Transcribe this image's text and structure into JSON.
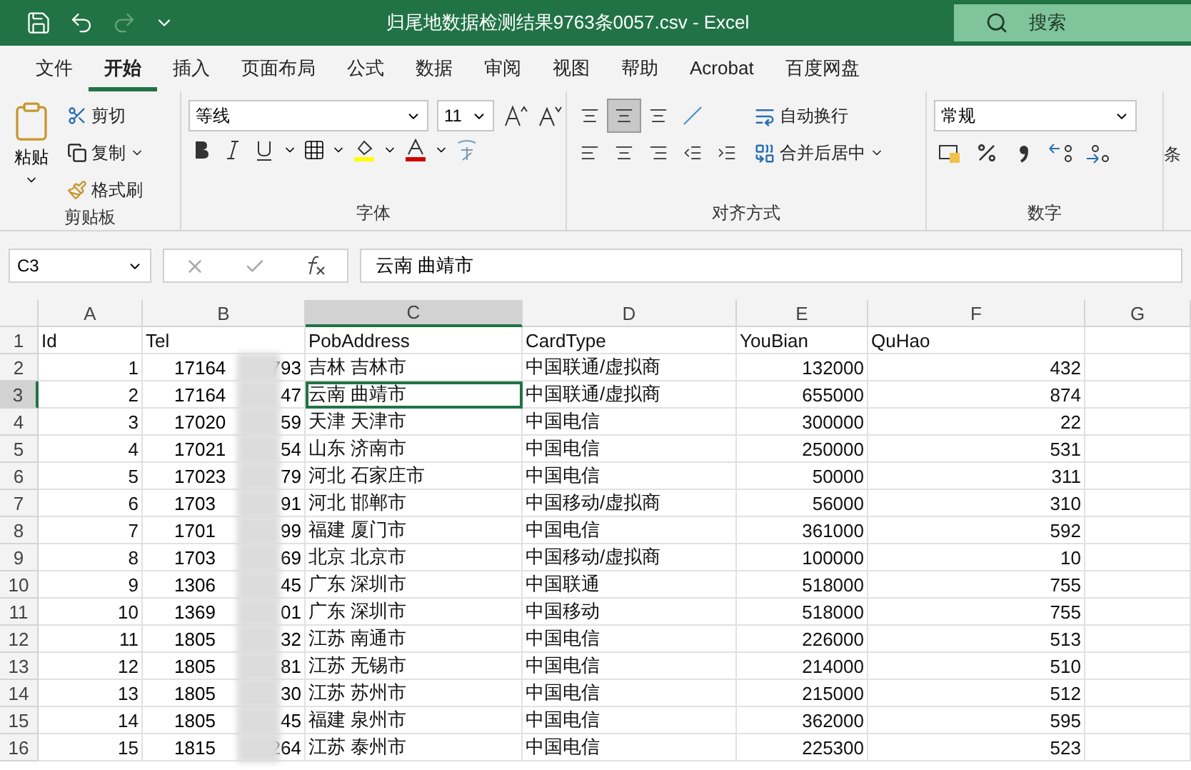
{
  "title_bar": {
    "title": "归尾地数据检测结果9763条0057.csv  -  Excel",
    "search": {
      "placeholder": "搜索"
    }
  },
  "menu_tabs": [
    {
      "label": "文件",
      "selected": false
    },
    {
      "label": "开始",
      "selected": true
    },
    {
      "label": "插入",
      "selected": false
    },
    {
      "label": "页面布局",
      "selected": false
    },
    {
      "label": "公式",
      "selected": false
    },
    {
      "label": "数据",
      "selected": false
    },
    {
      "label": "审阅",
      "selected": false
    },
    {
      "label": "视图",
      "selected": false
    },
    {
      "label": "帮助",
      "selected": false
    },
    {
      "label": "Acrobat",
      "selected": false
    },
    {
      "label": "百度网盘",
      "selected": false
    }
  ],
  "ribbon": {
    "clipboard": {
      "paste": "粘贴",
      "cut": "剪切",
      "copy": "复制",
      "format_painter": "格式刷",
      "label": "剪贴板"
    },
    "font": {
      "font_name": "等线",
      "font_size": "11",
      "label": "字体"
    },
    "alignment": {
      "wrap_text": "自动换行",
      "merge_center": "合并后居中",
      "label": "对齐方式"
    },
    "number": {
      "format": "常规",
      "label": "数字"
    },
    "next_group_label": "条"
  },
  "formula_bar": {
    "name_box": "C3",
    "value": "云南 曲靖市"
  },
  "sheet": {
    "columns": [
      {
        "label": "A",
        "selected": false
      },
      {
        "label": "B",
        "selected": false
      },
      {
        "label": "C",
        "selected": true
      },
      {
        "label": "D",
        "selected": false
      },
      {
        "label": "E",
        "selected": false
      },
      {
        "label": "F",
        "selected": false
      },
      {
        "label": "G",
        "selected": false
      }
    ],
    "header_row": {
      "number": "1",
      "cells": [
        "Id",
        "Tel",
        "PobAddress",
        "CardType",
        "YouBian",
        "QuHao"
      ]
    },
    "rows": [
      {
        "number": "2",
        "selected": false,
        "id": "1",
        "tel_start": "17164",
        "tel_end": "793",
        "address": "吉林 吉林市",
        "card_type": "中国联通/虚拟商",
        "you_bian": "132000",
        "qu_hao": "432"
      },
      {
        "number": "3",
        "selected": true,
        "id": "2",
        "tel_start": "17164",
        "tel_end": "47",
        "address": "云南 曲靖市",
        "card_type": "中国联通/虚拟商",
        "you_bian": "655000",
        "qu_hao": "874"
      },
      {
        "number": "4",
        "selected": false,
        "id": "3",
        "tel_start": "17020",
        "tel_end": "59",
        "address": "天津 天津市",
        "card_type": "中国电信",
        "you_bian": "300000",
        "qu_hao": "22"
      },
      {
        "number": "5",
        "selected": false,
        "id": "4",
        "tel_start": "17021",
        "tel_end": "54",
        "address": "山东 济南市",
        "card_type": "中国电信",
        "you_bian": "250000",
        "qu_hao": "531"
      },
      {
        "number": "6",
        "selected": false,
        "id": "5",
        "tel_start": "17023",
        "tel_end": "79",
        "address": "河北 石家庄市",
        "card_type": "中国电信",
        "you_bian": "50000",
        "qu_hao": "311"
      },
      {
        "number": "7",
        "selected": false,
        "id": "6",
        "tel_start": "1703",
        "tel_end": "91",
        "address": "河北 邯郸市",
        "card_type": "中国移动/虚拟商",
        "you_bian": "56000",
        "qu_hao": "310"
      },
      {
        "number": "8",
        "selected": false,
        "id": "7",
        "tel_start": "1701",
        "tel_end": "99",
        "address": "福建 厦门市",
        "card_type": "中国电信",
        "you_bian": "361000",
        "qu_hao": "592"
      },
      {
        "number": "9",
        "selected": false,
        "id": "8",
        "tel_start": "1703",
        "tel_end": "69",
        "address": "北京 北京市",
        "card_type": "中国移动/虚拟商",
        "you_bian": "100000",
        "qu_hao": "10"
      },
      {
        "number": "10",
        "selected": false,
        "id": "9",
        "tel_start": "1306",
        "tel_end": "45",
        "address": "广东 深圳市",
        "card_type": "中国联通",
        "you_bian": "518000",
        "qu_hao": "755"
      },
      {
        "number": "11",
        "selected": false,
        "id": "10",
        "tel_start": "1369",
        "tel_end": "01",
        "address": "广东 深圳市",
        "card_type": "中国移动",
        "you_bian": "518000",
        "qu_hao": "755"
      },
      {
        "number": "12",
        "selected": false,
        "id": "11",
        "tel_start": "1805",
        "tel_end": "32",
        "address": "江苏 南通市",
        "card_type": "中国电信",
        "you_bian": "226000",
        "qu_hao": "513"
      },
      {
        "number": "13",
        "selected": false,
        "id": "12",
        "tel_start": "1805",
        "tel_end": "81",
        "address": "江苏 无锡市",
        "card_type": "中国电信",
        "you_bian": "214000",
        "qu_hao": "510"
      },
      {
        "number": "14",
        "selected": false,
        "id": "13",
        "tel_start": "1805",
        "tel_end": "30",
        "address": "江苏 苏州市",
        "card_type": "中国电信",
        "you_bian": "215000",
        "qu_hao": "512"
      },
      {
        "number": "15",
        "selected": false,
        "id": "14",
        "tel_start": "1805",
        "tel_end": "45",
        "address": "福建 泉州市",
        "card_type": "中国电信",
        "you_bian": "362000",
        "qu_hao": "595"
      },
      {
        "number": "16",
        "selected": false,
        "id": "15",
        "tel_start": "1815",
        "tel_end": "264",
        "address": "江苏 泰州市",
        "card_type": "中国电信",
        "you_bian": "225300",
        "qu_hao": "523"
      }
    ]
  }
}
